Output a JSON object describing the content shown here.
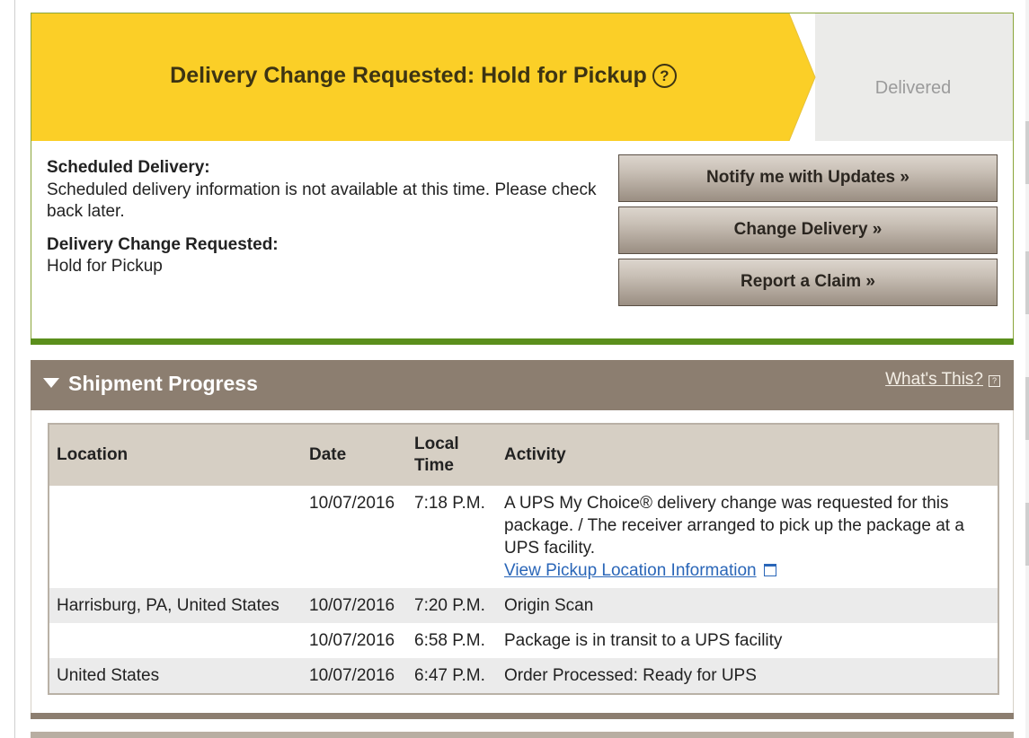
{
  "status": {
    "title": "Delivery Change Requested: Hold for Pickup",
    "help_glyph": "?",
    "next_step": "Delivered",
    "colors": {
      "banner": "#fbcf27",
      "banner_inactive": "#ebebe9",
      "bar": "#5b8f1c"
    }
  },
  "details": {
    "scheduled_heading": "Scheduled Delivery:",
    "scheduled_text": "Scheduled delivery information is not available at this time. Please check back later.",
    "change_heading": "Delivery Change Requested:",
    "change_text": "Hold for Pickup"
  },
  "actions": {
    "notify": "Notify me with Updates »",
    "change": "Change Delivery »",
    "claim": "Report a Claim »"
  },
  "progress": {
    "title": "Shipment Progress",
    "whats_this": "What's This?",
    "whats_this_glyph": "?",
    "columns": {
      "location": "Location",
      "date": "Date",
      "time": "Local Time",
      "activity": "Activity"
    },
    "rows": [
      {
        "location": "",
        "date": "10/07/2016",
        "time": "7:18 P.M.",
        "activity": "A UPS My Choice® delivery change was requested for this package. / The receiver arranged to pick up the package at a UPS facility.",
        "link": "View Pickup Location Information"
      },
      {
        "location": "Harrisburg, PA, United States",
        "date": "10/07/2016",
        "time": "7:20 P.M.",
        "activity": "Origin Scan"
      },
      {
        "location": "",
        "date": "10/07/2016",
        "time": "6:58 P.M.",
        "activity": "Package is in transit to a UPS facility"
      },
      {
        "location": "United States",
        "date": "10/07/2016",
        "time": "6:47 P.M.",
        "activity": "Order Processed: Ready for UPS"
      }
    ]
  }
}
